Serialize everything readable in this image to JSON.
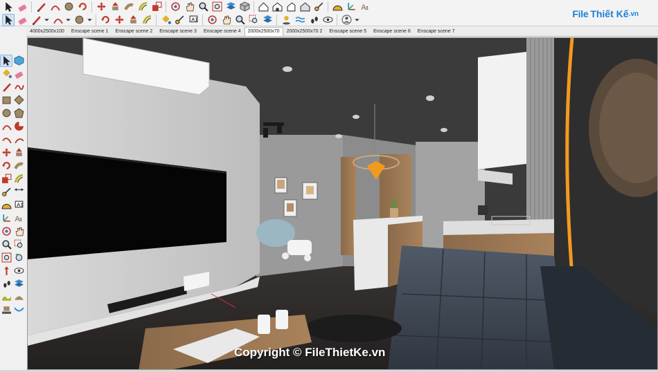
{
  "app": {
    "colors": {
      "toolbar_bg": "#f3f3f3",
      "tab_active_bg": "#ffffff",
      "accent_orange": "#f29a1f",
      "watermark_blue": "#1b7fd6"
    }
  },
  "toolbar": {
    "row1": [
      "select-icon",
      "eraser-icon",
      "pencil-icon",
      "arc-icon",
      "circle-icon",
      "rotate-icon",
      "move-icon",
      "push-pull-icon",
      "follow-me-icon",
      "offset-icon",
      "scale-icon",
      "orbit-icon",
      "pan-icon",
      "zoom-icon",
      "zoom-extents-icon",
      "section-icon",
      "iso-view-icon",
      "top-view-icon",
      "front-view-icon",
      "right-view-icon",
      "back-view-icon",
      "tape-icon",
      "protractor-icon",
      "axes-icon",
      "3d-text-icon"
    ],
    "row2": [
      "select-icon",
      "eraser-icon",
      "pencil-icon",
      "arc-icon",
      "circle-icon",
      "rotate-icon",
      "move-icon",
      "push-pull-icon",
      "offset-icon",
      "paint-icon",
      "tape-icon",
      "text-icon",
      "orbit-icon",
      "pan-icon",
      "zoom-icon",
      "zoom-window-icon",
      "section-icon",
      "shadow-icon",
      "fog-icon",
      "walk-icon",
      "look-icon",
      "account-icon"
    ]
  },
  "scene_tabs": [
    {
      "label": "4000x2500x100"
    },
    {
      "label": "Enscape scene 1"
    },
    {
      "label": "Enscape scene 2"
    },
    {
      "label": "Enscape scene 3"
    },
    {
      "label": "Enscape scene 4"
    },
    {
      "label": "2000x2500x70",
      "active": true
    },
    {
      "label": "2000x2500x70 2"
    },
    {
      "label": "Enscape scene 5"
    },
    {
      "label": "Enscape scene 6"
    },
    {
      "label": "Enscape scene 7"
    }
  ],
  "left_toolbar": {
    "rows": [
      [
        "select-icon",
        "component-icon"
      ],
      [
        "paint-icon",
        "eraser-icon"
      ],
      [
        "line-icon",
        "freehand-icon"
      ],
      [
        "rectangle-icon",
        "rotated-rect-icon"
      ],
      [
        "circle-icon",
        "polygon-icon"
      ],
      [
        "arc-icon",
        "pie-icon"
      ],
      [
        "arc3-icon",
        "arc2-icon"
      ],
      [
        "move-icon",
        "push-pull-icon"
      ],
      [
        "rotate-icon",
        "follow-me-icon"
      ],
      [
        "scale-icon",
        "offset-icon"
      ],
      [
        "tape-icon",
        "dimension-icon"
      ],
      [
        "protractor-icon",
        "text-icon"
      ],
      [
        "axes-icon",
        "3d-text-icon"
      ],
      [
        "orbit-icon",
        "pan-icon"
      ],
      [
        "zoom-icon",
        "zoom-window-icon"
      ],
      [
        "zoom-extents-icon",
        "previous-icon"
      ],
      [
        "position-camera-icon",
        "look-icon"
      ],
      [
        "walk-icon",
        "section-icon"
      ],
      [
        "sandbox-icon",
        "smoove-icon"
      ],
      [
        "stamp-icon",
        "drape-icon"
      ]
    ]
  },
  "watermark": {
    "brand_file": "File",
    "brand_thiet_ke": "Thiết Kế",
    "brand_suffix": ".vn",
    "copyright": "Copyright © FileThietKe.vn"
  }
}
